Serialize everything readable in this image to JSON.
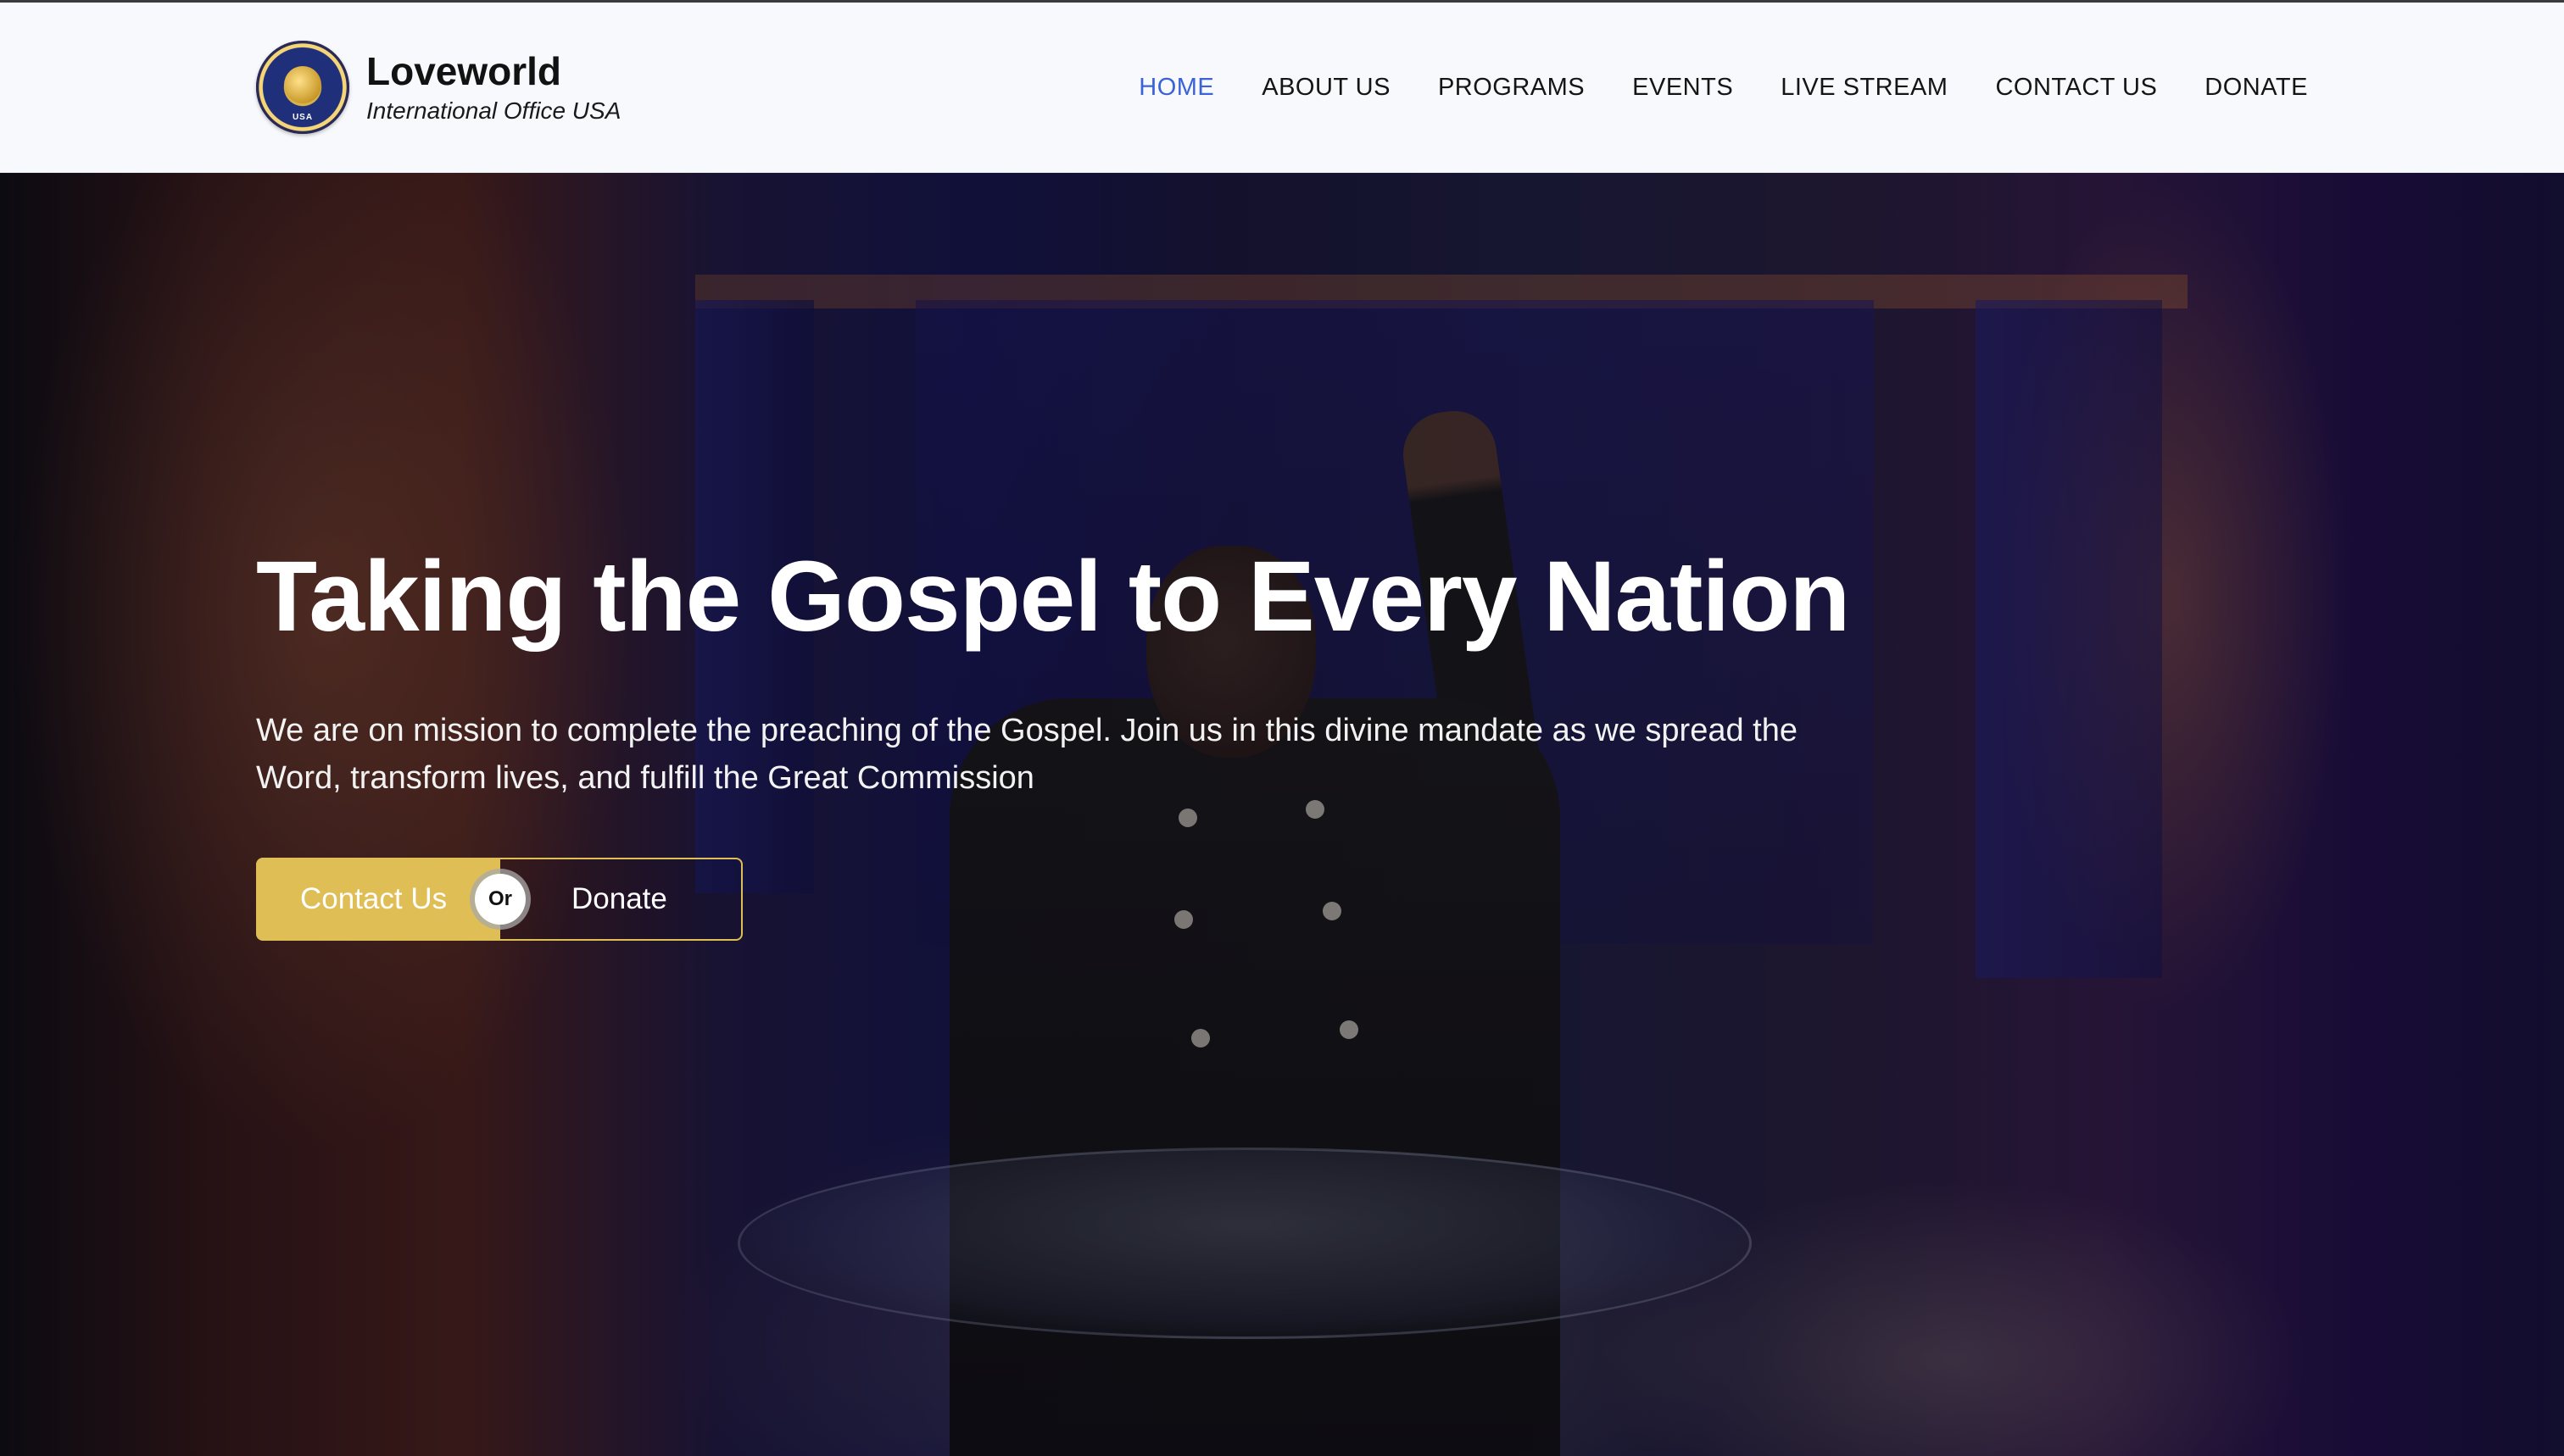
{
  "brand": {
    "title": "Loveworld",
    "subtitle": "International Office USA",
    "logo_text": "USA"
  },
  "nav": {
    "items": [
      {
        "label": "HOME",
        "active": true
      },
      {
        "label": "ABOUT US",
        "active": false
      },
      {
        "label": "PROGRAMS",
        "active": false
      },
      {
        "label": "EVENTS",
        "active": false
      },
      {
        "label": "LIVE STREAM",
        "active": false
      },
      {
        "label": "CONTACT US",
        "active": false
      },
      {
        "label": "DONATE",
        "active": false
      }
    ]
  },
  "hero": {
    "title": "Taking the Gospel to Every Nation",
    "description": "We are on mission to complete the preaching of the Gospel. Join us in this divine mandate as we spread the Word, transform lives, and fulfill the Great Commission",
    "contact_label": "Contact Us",
    "or_label": "Or",
    "donate_label": "Donate"
  },
  "colors": {
    "accent": "#dfbe55",
    "nav_active": "#3a63d8",
    "header_bg": "#f7f9fc",
    "text_dark": "#151515"
  }
}
